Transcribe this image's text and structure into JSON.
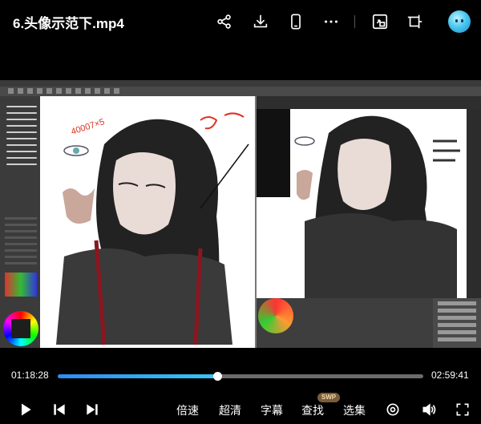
{
  "header": {
    "title": "6.头像示范下.mp4",
    "icons": [
      "share-icon",
      "download-icon",
      "phone-icon",
      "more-icon",
      "screen-cast-icon",
      "crop-window-icon",
      "avatar"
    ]
  },
  "video": {
    "description_icons": [
      "brush-icon",
      "color-wheel-icon"
    ],
    "sketch_note": "40007×5"
  },
  "player": {
    "current_time": "01:18:28",
    "total_time": "02:59:41",
    "progress": 0.4369,
    "buttons": {
      "speed": "倍速",
      "quality": "超清",
      "subtitle": "字幕",
      "search": "查找",
      "episodes": "选集",
      "svip_badge": "SWP"
    },
    "colors": {
      "progress_start": "#2f8bf5",
      "progress_end": "#38c6f2",
      "track": "#6b6b6b",
      "background": "#000000"
    }
  }
}
